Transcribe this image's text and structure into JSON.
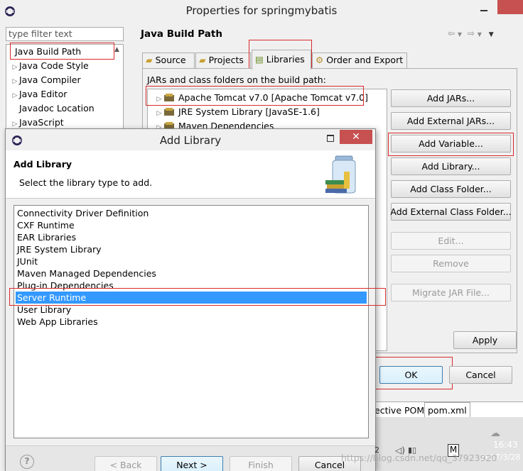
{
  "window": {
    "title": "Properties for springmybatis"
  },
  "filter": {
    "placeholder": "type filter text"
  },
  "nav": {
    "items": [
      {
        "label": "Java Build Path",
        "expandable": false
      },
      {
        "label": "Java Code Style",
        "expandable": true
      },
      {
        "label": "Java Compiler",
        "expandable": true
      },
      {
        "label": "Java Editor",
        "expandable": true
      },
      {
        "label": "Javadoc Location",
        "expandable": false
      },
      {
        "label": "JavaScript",
        "expandable": true
      }
    ]
  },
  "page": {
    "title": "Java Build Path",
    "tabs": [
      "Source",
      "Projects",
      "Libraries",
      "Order and Export"
    ],
    "active_tab": "Libraries",
    "description": "JARs and class folders on the build path:",
    "libraries": [
      "Apache Tomcat v7.0 [Apache Tomcat v7.0]",
      "JRE System Library [JavaSE-1.6]",
      "Maven Dependencies"
    ],
    "buttons": {
      "add_jars": "Add JARs...",
      "add_external_jars": "Add External JARs...",
      "add_variable": "Add Variable...",
      "add_library": "Add Library...",
      "add_class_folder": "Add Class Folder...",
      "add_external_class_folder": "Add External Class Folder...",
      "edit": "Edit...",
      "remove": "Remove",
      "migrate_jar": "Migrate JAR File..."
    },
    "apply": "Apply",
    "ok": "OK",
    "cancel": "Cancel"
  },
  "editor_tabs": {
    "effective_pom": "ective POM",
    "pom_xml": "pom.xml"
  },
  "dialog": {
    "title": "Add Library",
    "heading": "Add Library",
    "subtitle": "Select the library type to add.",
    "library_types": [
      "Connectivity Driver Definition",
      "CXF Runtime",
      "EAR Libraries",
      "JRE System Library",
      "JUnit",
      "Maven Managed Dependencies",
      "Plug-in Dependencies",
      "Server Runtime",
      "User Library",
      "Web App Libraries"
    ],
    "selected": "Server Runtime",
    "buttons": {
      "back": "< Back",
      "next": "Next >",
      "finish": "Finish",
      "cancel": "Cancel"
    }
  },
  "taskbar": {
    "time": "16:43",
    "date": "2017/3/28",
    "ime": "M"
  },
  "watermark": "https://blog.csdn.net/qq_37923920",
  "colors": {
    "selection": "#3399ff",
    "annotation": "#d92b2b",
    "close": "#c75050"
  }
}
